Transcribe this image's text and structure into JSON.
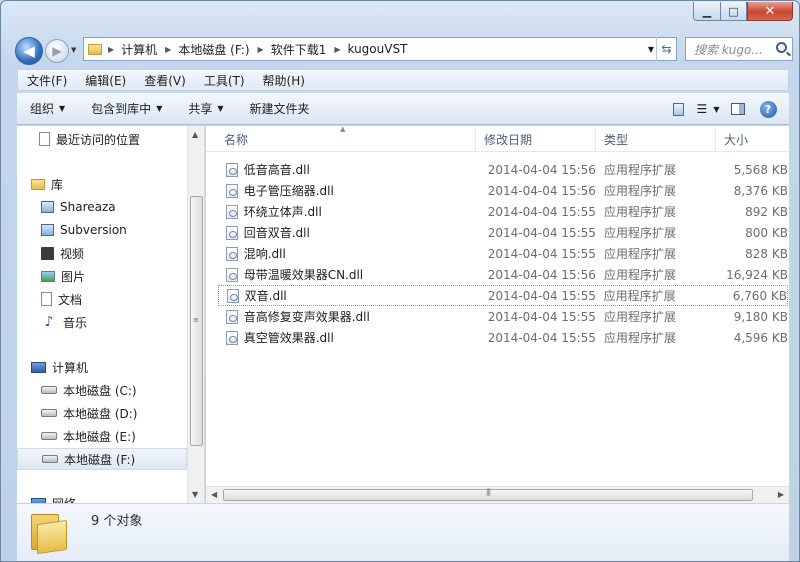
{
  "window": {
    "controls": {
      "minimize": "▁",
      "maximize": "□",
      "close": "✕"
    }
  },
  "nav": {
    "back_icon": "arrow-left-icon",
    "forward_icon": "arrow-right-icon",
    "address": [
      "计算机",
      "本地磁盘 (F:)",
      "软件下载1",
      "kugouVST"
    ],
    "search_placeholder": "搜索 kugo..."
  },
  "menu": [
    "文件(F)",
    "编辑(E)",
    "查看(V)",
    "工具(T)",
    "帮助(H)"
  ],
  "commands": {
    "organize": "组织",
    "include_library": "包含到库中",
    "share": "共享",
    "new_folder": "新建文件夹"
  },
  "sidebar": {
    "recent": "最近访问的位置",
    "library": "库",
    "lib_items": [
      "Shareaza",
      "Subversion",
      "视频",
      "图片",
      "文档",
      "音乐"
    ],
    "computer": "计算机",
    "drives": [
      "本地磁盘 (C:)",
      "本地磁盘 (D:)",
      "本地磁盘 (E:)",
      "本地磁盘 (F:)"
    ],
    "network": "网络"
  },
  "columns": {
    "name": "名称",
    "date": "修改日期",
    "type": "类型",
    "size": "大小"
  },
  "files": [
    {
      "name": "低音高音.dll",
      "date": "2014-04-04 15:56",
      "type": "应用程序扩展",
      "size": "5,568 KB"
    },
    {
      "name": "电子管压缩器.dll",
      "date": "2014-04-04 15:56",
      "type": "应用程序扩展",
      "size": "8,376 KB"
    },
    {
      "name": "环绕立体声.dll",
      "date": "2014-04-04 15:55",
      "type": "应用程序扩展",
      "size": "892 KB"
    },
    {
      "name": "回音双音.dll",
      "date": "2014-04-04 15:55",
      "type": "应用程序扩展",
      "size": "800 KB"
    },
    {
      "name": "混响.dll",
      "date": "2014-04-04 15:55",
      "type": "应用程序扩展",
      "size": "828 KB"
    },
    {
      "name": "母带温暖效果器CN.dll",
      "date": "2014-04-04 15:56",
      "type": "应用程序扩展",
      "size": "16,924 KB"
    },
    {
      "name": "双音.dll",
      "date": "2014-04-04 15:55",
      "type": "应用程序扩展",
      "size": "6,760 KB"
    },
    {
      "name": "音高修复变声效果器.dll",
      "date": "2014-04-04 15:55",
      "type": "应用程序扩展",
      "size": "9,180 KB"
    },
    {
      "name": "真空管效果器.dll",
      "date": "2014-04-04 15:55",
      "type": "应用程序扩展",
      "size": "4,596 KB"
    }
  ],
  "status": {
    "count": "9 个对象"
  }
}
